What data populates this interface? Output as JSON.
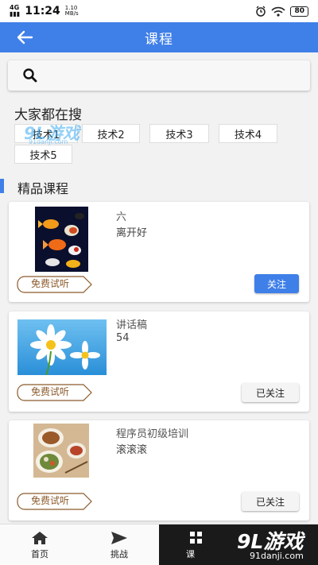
{
  "status_bar": {
    "signal": "4G░",
    "time": "11:24",
    "speed": "1.10 MB/s",
    "battery": "80"
  },
  "app_bar": {
    "title": "课程"
  },
  "search": {
    "placeholder": ""
  },
  "hot": {
    "title": "大家都在搜",
    "tags": [
      "技术1",
      "技术2",
      "技术3",
      "技术4",
      "技术5"
    ]
  },
  "section": {
    "title": "精品课程"
  },
  "courses": [
    {
      "title": "六",
      "subtitle": "离开好",
      "trial": "免费试听",
      "follow": "关注",
      "image": "goldfish"
    },
    {
      "title": "讲话稿",
      "subtitle": "54",
      "trial": "免费试听",
      "follow": "已关注",
      "image": "daisy"
    },
    {
      "title": "程序员初级培训",
      "subtitle": "滚滚滚",
      "trial": "免费试听",
      "follow": "已关注",
      "image": "food"
    }
  ],
  "nav": [
    {
      "label": "首页",
      "icon": "home-icon"
    },
    {
      "label": "挑战",
      "icon": "send-icon"
    },
    {
      "label": "课",
      "icon": "grid-icon"
    }
  ],
  "watermark": {
    "top": "9L游戏",
    "top_url": "91danji.com",
    "bottom": "9L游戏",
    "bottom_url": "91danji.com"
  },
  "colors": {
    "primary": "#3f7fe8",
    "trial_border": "#8b5a2b"
  }
}
